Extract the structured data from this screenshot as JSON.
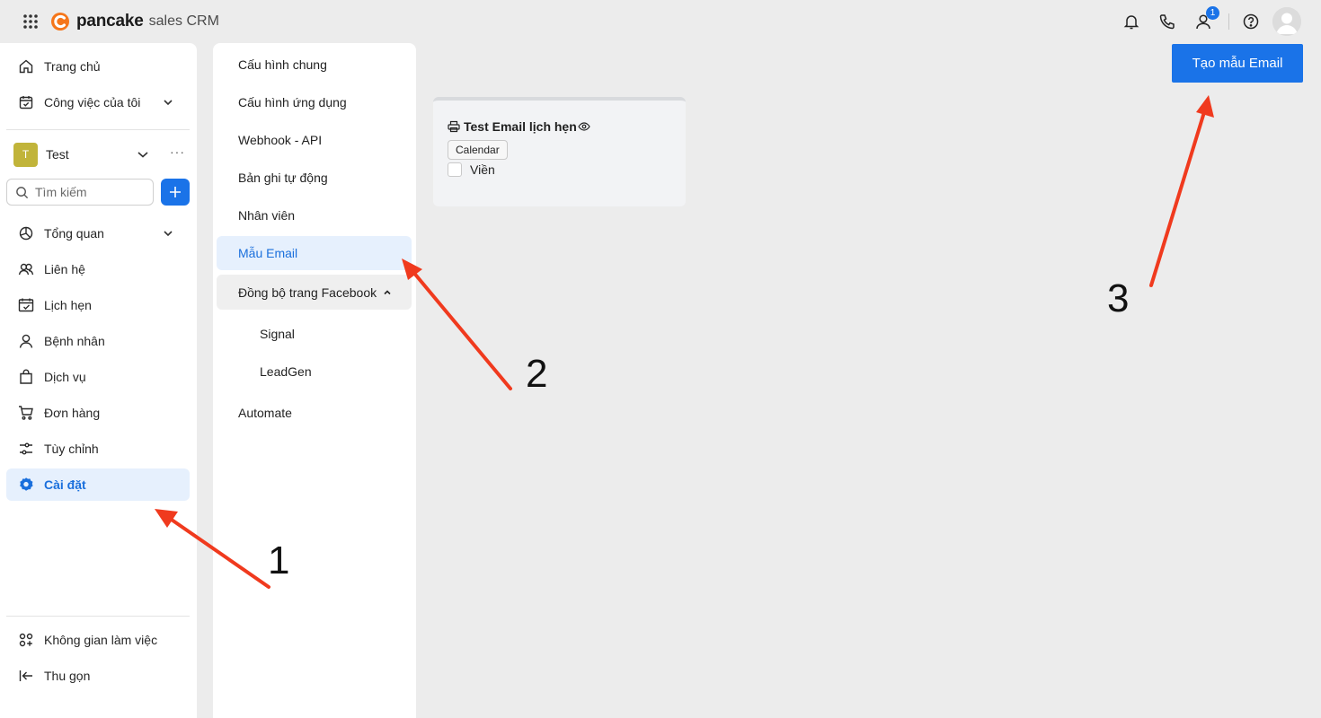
{
  "brand": {
    "name": "pancake",
    "product": "sales CRM",
    "accent": "#1a73e8",
    "logo_color": "#f5761a"
  },
  "topbar": {
    "icons": [
      "apps-grid-icon",
      "bell-icon",
      "phone-icon",
      "user-icon",
      "help-icon"
    ],
    "notification_count": "1"
  },
  "sidebar": {
    "top_items": [
      {
        "label": "Trang chủ",
        "icon": "home-icon"
      },
      {
        "label": "Công việc của tôi",
        "icon": "calendar-task-icon"
      }
    ],
    "workspace": {
      "initial": "T",
      "name": "Test",
      "more": "···"
    },
    "search_placeholder": "Tìm kiếm",
    "items": [
      {
        "label": "Tổng quan",
        "icon": "pie-chart-icon"
      },
      {
        "label": "Liên hệ",
        "icon": "contacts-icon"
      },
      {
        "label": "Lịch hẹn",
        "icon": "calendar-check-icon"
      },
      {
        "label": "Bệnh nhân",
        "icon": "person-icon"
      },
      {
        "label": "Dịch vụ",
        "icon": "shopping-bag-icon"
      },
      {
        "label": "Đơn hàng",
        "icon": "cart-icon"
      },
      {
        "label": "Tùy chỉnh",
        "icon": "sliders-icon"
      },
      {
        "label": "Cài đặt",
        "icon": "gear-icon",
        "active": true
      }
    ],
    "bottom_items": [
      {
        "label": "Không gian làm việc",
        "icon": "workspace-icon"
      },
      {
        "label": "Thu gọn",
        "icon": "collapse-icon"
      }
    ]
  },
  "settings_menu": {
    "items": [
      {
        "label": "Cấu hình chung"
      },
      {
        "label": "Cấu hình ứng dụng"
      },
      {
        "label": "Webhook - API"
      },
      {
        "label": "Bản ghi tự động"
      },
      {
        "label": "Nhân viên"
      },
      {
        "label": "Mẫu Email",
        "active": true
      },
      {
        "label": "Đồng bộ trang Facebook",
        "expanded": true
      },
      {
        "label": "Signal",
        "sub": true
      },
      {
        "label": "LeadGen",
        "sub": true
      },
      {
        "label": "Automate"
      }
    ]
  },
  "main": {
    "create_button": "Tạo mẫu Email",
    "templates": [
      {
        "title": "Test Email lịch hẹn",
        "tag": "Calendar",
        "checkbox_label": "Viền",
        "checked": false
      }
    ]
  },
  "annotations": {
    "labels": [
      "1",
      "2",
      "3"
    ],
    "color": "#f03a1e"
  }
}
